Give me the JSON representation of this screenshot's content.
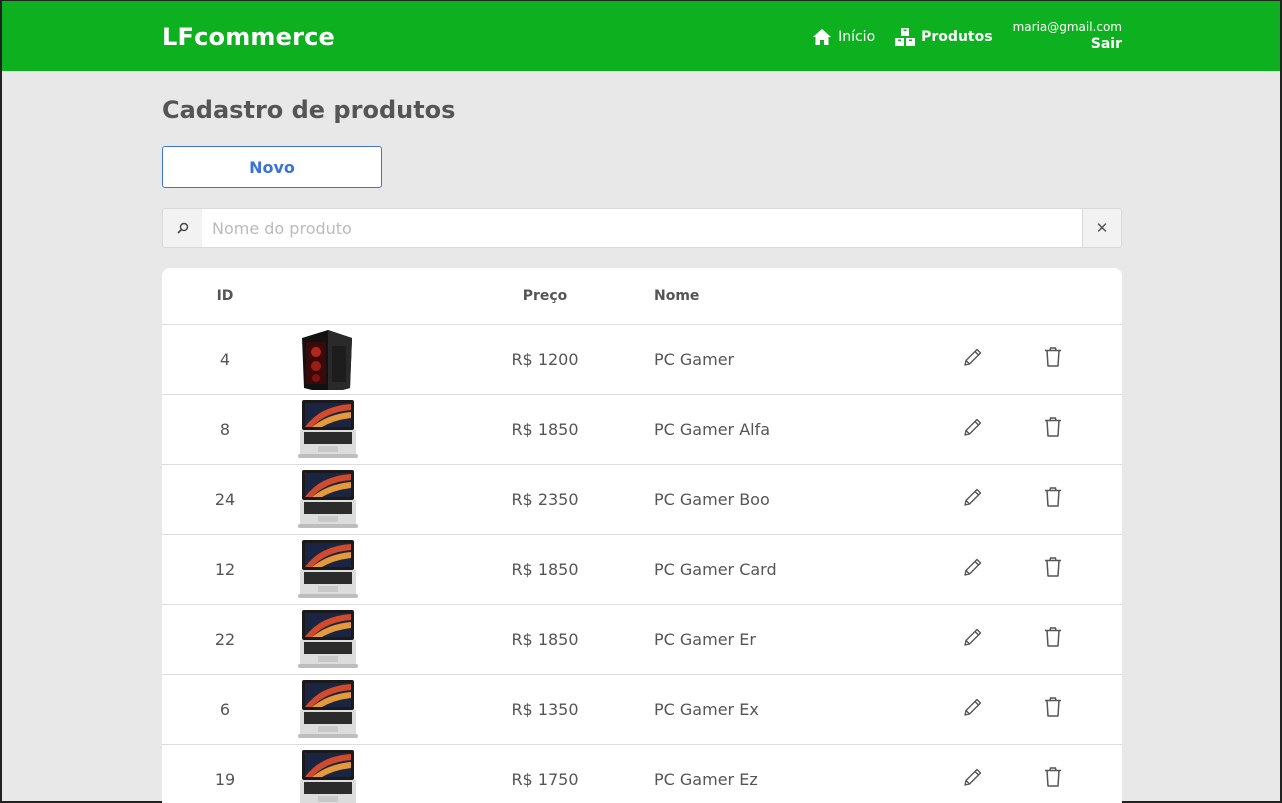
{
  "header": {
    "brand": "LFcommerce",
    "nav": [
      {
        "label": "Início",
        "icon": "home-icon",
        "active": false
      },
      {
        "label": "Produtos",
        "icon": "boxes-icon",
        "active": true
      }
    ],
    "user": {
      "email": "maria@gmail.com",
      "logout_label": "Sair"
    }
  },
  "page": {
    "title": "Cadastro de produtos",
    "new_button": "Novo",
    "search": {
      "placeholder": "Nome do produto",
      "value": "",
      "clear": "✕"
    }
  },
  "table": {
    "columns": {
      "id": "ID",
      "image": "",
      "price": "Preço",
      "name": "Nome"
    },
    "rows": [
      {
        "id": "4",
        "image": "pc-tower",
        "price": "R$ 1200",
        "name": "PC Gamer"
      },
      {
        "id": "8",
        "image": "laptop",
        "price": "R$ 1850",
        "name": "PC Gamer Alfa"
      },
      {
        "id": "24",
        "image": "laptop",
        "price": "R$ 2350",
        "name": "PC Gamer Boo"
      },
      {
        "id": "12",
        "image": "laptop",
        "price": "R$ 1850",
        "name": "PC Gamer Card"
      },
      {
        "id": "22",
        "image": "laptop",
        "price": "R$ 1850",
        "name": "PC Gamer Er"
      },
      {
        "id": "6",
        "image": "laptop",
        "price": "R$ 1350",
        "name": "PC Gamer Ex"
      },
      {
        "id": "19",
        "image": "laptop",
        "price": "R$ 1750",
        "name": "PC Gamer Ez"
      }
    ]
  },
  "colors": {
    "header_bg": "#0db11f",
    "page_bg": "#e8e8e8",
    "accent": "#3b73d9"
  }
}
